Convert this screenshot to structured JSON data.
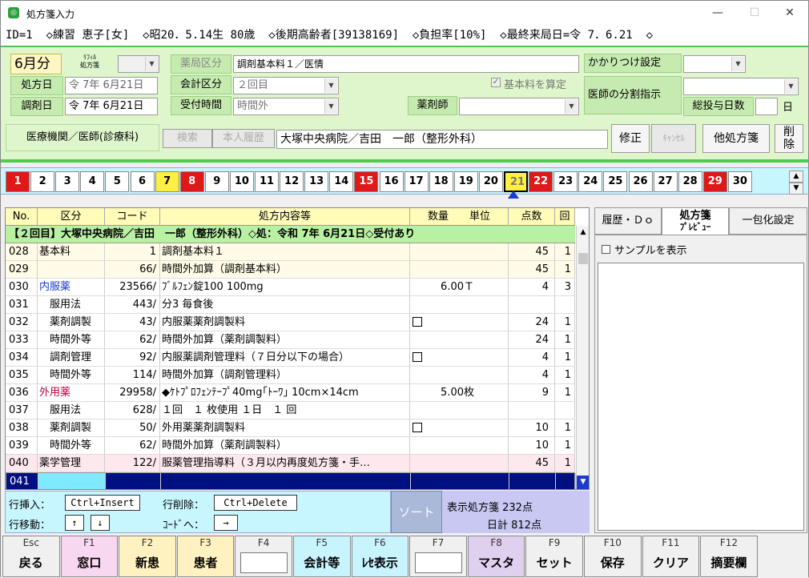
{
  "window": {
    "title": "処方箋入力",
    "icon": "app-icon"
  },
  "info": "ID=1  ◇練習 恵子[女]  ◇昭20．5.14生 80歳  ◇後期高齢者[39138169]  ◇負担率[10%]  ◇最終来局日=令 7．6.21  ◇",
  "form": {
    "month": "6月分",
    "refill_label1": "ﾘﾌｨﾙ",
    "refill_label2": "処方箋",
    "rx_date_label": "処方日",
    "rx_date": "令 7年 6月21日",
    "dispense_date_label": "調剤日",
    "dispense_date": "令 7年 6月21日",
    "pharmacy_category_label": "薬局区分",
    "pharmacy_category": "調剤基本料１／医情",
    "accounting_label": "会計区分",
    "accounting": "２回目",
    "reception_label": "受付時間",
    "reception": "時間外",
    "base_fee_check": "基本料を算定",
    "pharmacist_label": "薬剤師",
    "kakaritsuke_label": "かかりつけ設定",
    "doctor_split_label": "医師の分割指示",
    "total_days_label": "総投与日数",
    "day_unit": "日",
    "institution_label": "医療機関／医師(診療科)",
    "search": "検索",
    "history": "本人履歴",
    "institution": "大塚中央病院／吉田　一郎（整形外科）",
    "edit": "修正",
    "cancel": "ｷｬﾝｾﾙ",
    "other_rx": "他処方箋",
    "delete1": "削",
    "delete2": "除"
  },
  "days": [
    {
      "n": "1",
      "s": "red"
    },
    {
      "n": "2",
      "s": ""
    },
    {
      "n": "3",
      "s": ""
    },
    {
      "n": "4",
      "s": ""
    },
    {
      "n": "5",
      "s": ""
    },
    {
      "n": "6",
      "s": ""
    },
    {
      "n": "7",
      "s": "yel"
    },
    {
      "n": "8",
      "s": "red"
    },
    {
      "n": "9",
      "s": ""
    },
    {
      "n": "10",
      "s": ""
    },
    {
      "n": "11",
      "s": ""
    },
    {
      "n": "12",
      "s": ""
    },
    {
      "n": "13",
      "s": ""
    },
    {
      "n": "14",
      "s": ""
    },
    {
      "n": "15",
      "s": "red"
    },
    {
      "n": "16",
      "s": ""
    },
    {
      "n": "17",
      "s": ""
    },
    {
      "n": "18",
      "s": ""
    },
    {
      "n": "19",
      "s": ""
    },
    {
      "n": "20",
      "s": ""
    },
    {
      "n": "21",
      "s": "sel"
    },
    {
      "n": "22",
      "s": "red"
    },
    {
      "n": "23",
      "s": ""
    },
    {
      "n": "24",
      "s": ""
    },
    {
      "n": "25",
      "s": ""
    },
    {
      "n": "26",
      "s": ""
    },
    {
      "n": "27",
      "s": ""
    },
    {
      "n": "28",
      "s": ""
    },
    {
      "n": "29",
      "s": "red"
    },
    {
      "n": "30",
      "s": ""
    }
  ],
  "grid": {
    "headers": {
      "no": "No.",
      "kubun": "区分",
      "code": "コード",
      "name": "処方内容等",
      "qty": "数量　　単位",
      "pts": "点数",
      "times": "回"
    },
    "banner": "【２回目】大塚中央病院／吉田　一郎（整形外科）◇処：令和 7年 6月21日◇受付あり",
    "rows": [
      {
        "no": "028",
        "ku": "基本料",
        "kc": "#000",
        "code": "1",
        "name": "調剤基本料１",
        "qty": "",
        "pts": "45",
        "times": "1",
        "bg": "yel",
        "m": false
      },
      {
        "no": "029",
        "ku": "",
        "kc": "#000",
        "code": "66/",
        "name": "時間外加算（調剤基本料）",
        "qty": "",
        "pts": "45",
        "times": "1",
        "bg": "yel",
        "m": false
      },
      {
        "no": "030",
        "ku": "内服薬",
        "kc": "#1a3ad0",
        "code": "23566/",
        "name": "ﾌﾞﾙﾌｪﾝ錠100 100mg",
        "qty": "6.00Ｔ",
        "pts": "4",
        "times": "3",
        "bg": "",
        "m": false
      },
      {
        "no": "031",
        "ku": "　服用法",
        "kc": "#000",
        "code": "443/",
        "name": "分3 毎食後",
        "qty": "",
        "pts": "",
        "times": "",
        "bg": "",
        "m": false
      },
      {
        "no": "032",
        "ku": "　薬剤調製",
        "kc": "#000",
        "code": "43/",
        "name": "内服薬薬剤調製料",
        "qty": "",
        "pts": "24",
        "times": "1",
        "bg": "",
        "m": true
      },
      {
        "no": "033",
        "ku": "　時間外等",
        "kc": "#000",
        "code": "62/",
        "name": "時間外加算（薬剤調製料）",
        "qty": "",
        "pts": "24",
        "times": "1",
        "bg": "",
        "m": false
      },
      {
        "no": "034",
        "ku": "　調剤管理",
        "kc": "#000",
        "code": "92/",
        "name": "内服薬調剤管理料（７日分以下の場合）",
        "qty": "",
        "pts": "4",
        "times": "1",
        "bg": "",
        "m": true
      },
      {
        "no": "035",
        "ku": "　時間外等",
        "kc": "#000",
        "code": "114/",
        "name": "時間外加算（調剤管理料）",
        "qty": "",
        "pts": "4",
        "times": "1",
        "bg": "",
        "m": false
      },
      {
        "no": "036",
        "ku": "外用薬",
        "kc": "#c0003a",
        "code": "29958/",
        "name": "◆ｹﾄﾌﾟﾛﾌｪﾝﾃｰﾌﾟ40mg｢ﾄｰﾜ｣ 10cm×14cm",
        "qty": "5.00枚",
        "pts": "9",
        "times": "1",
        "bg": "",
        "m": false
      },
      {
        "no": "037",
        "ku": "　服用法",
        "kc": "#000",
        "code": "628/",
        "name": "１回　１ 枚使用 １日　１ 回",
        "qty": "",
        "pts": "",
        "times": "",
        "bg": "",
        "m": false
      },
      {
        "no": "038",
        "ku": "　薬剤調製",
        "kc": "#000",
        "code": "50/",
        "name": "外用薬薬剤調製料",
        "qty": "",
        "pts": "10",
        "times": "1",
        "bg": "",
        "m": true
      },
      {
        "no": "039",
        "ku": "　時間外等",
        "kc": "#000",
        "code": "62/",
        "name": "時間外加算（薬剤調製料）",
        "qty": "",
        "pts": "10",
        "times": "1",
        "bg": "",
        "m": false
      },
      {
        "no": "040",
        "ku": "薬学管理",
        "kc": "#000",
        "code": "122/",
        "name": "服薬管理指導料（３月以内再度処方箋・手…",
        "qty": "",
        "pts": "45",
        "times": "1",
        "bg": "pink",
        "m": false
      },
      {
        "no": "041",
        "ku": "",
        "kc": "#000",
        "code": "",
        "name": "",
        "qty": "",
        "pts": "",
        "times": "",
        "bg": "sel",
        "m": false
      }
    ]
  },
  "cmd": {
    "insert_label": "行挿入：",
    "insert_key": "Ctrl+Insert",
    "delete_label": "行削除：",
    "delete_key": "Ctrl+Delete",
    "move_label": "行移動：",
    "up": "↑",
    "down": "↓",
    "code_label": "ｺｰﾄﾞへ：",
    "code_key": "→",
    "sort": "ソート",
    "shown_total": "表示処方箋 232点",
    "day_total": "日計 812点"
  },
  "right": {
    "tab1": "履歴・Ｄｏ",
    "tab2a": "処方箋",
    "tab2b": "ﾌﾟﾚﾋﾞｭｰ",
    "tab3": "一包化設定",
    "sample": "サンプルを表示"
  },
  "fkeys": [
    {
      "k": "Esc",
      "v": "戻る",
      "bg": "#f0f0f0"
    },
    {
      "k": "F1",
      "v": "窓口",
      "bg": "#f8d8f0"
    },
    {
      "k": "F2",
      "v": "新患",
      "bg": "#fff2c0"
    },
    {
      "k": "F3",
      "v": "患者",
      "bg": "#fff2c0"
    },
    {
      "k": "F4",
      "v": "",
      "bg": "#f0f0f0"
    },
    {
      "k": "F5",
      "v": "会計等",
      "bg": "#c8f4ff"
    },
    {
      "k": "F6",
      "v": "ﾚｾ表示",
      "bg": "#c8f4ff"
    },
    {
      "k": "F7",
      "v": "",
      "bg": "#f0f0f0"
    },
    {
      "k": "F8",
      "v": "マスタ",
      "bg": "#e0d0f0"
    },
    {
      "k": "F9",
      "v": "セット",
      "bg": "#f0f0f0"
    },
    {
      "k": "F10",
      "v": "保存",
      "bg": "#f0f0f0"
    },
    {
      "k": "F11",
      "v": "クリア",
      "bg": "#f0f0f0"
    },
    {
      "k": "F12",
      "v": "摘要欄",
      "bg": "#f0f0f0"
    }
  ]
}
